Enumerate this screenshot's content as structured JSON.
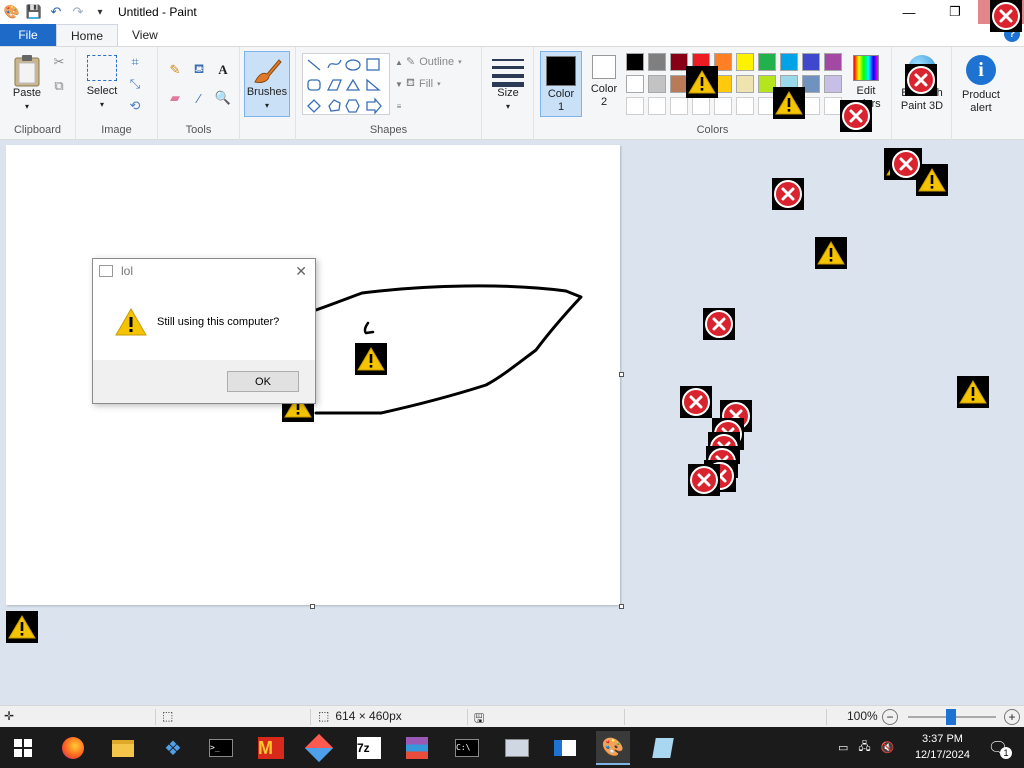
{
  "window": {
    "title": "Untitled - Paint",
    "minimize_glyph": "—",
    "restore_glyph": "❐",
    "close_glyph": "✕"
  },
  "tabs": [
    {
      "label": "File"
    },
    {
      "label": "Home"
    },
    {
      "label": "View"
    }
  ],
  "ribbon": {
    "clipboard": {
      "paste_label": "Paste",
      "group_label": "Clipboard"
    },
    "image": {
      "select_label": "Select",
      "group_label": "Image"
    },
    "tools": {
      "group_label": "Tools"
    },
    "brushes": {
      "label": "Brushes"
    },
    "shapes": {
      "outline_label": "Outline",
      "fill_label": "Fill",
      "group_label": "Shapes"
    },
    "size": {
      "label": "Size"
    },
    "colors": {
      "color1_label": "Color 1",
      "color2_label": "Color 2",
      "group_label": "Colors",
      "edit_label": "Edit colors",
      "paint3d_label": "Edit with Paint 3D",
      "product_alert_label": "Product alert",
      "color1": "#000000",
      "color2": "#ffffff",
      "palette_row1": [
        "#000000",
        "#7f7f7f",
        "#880015",
        "#ed1c24",
        "#ff7f27",
        "#fff200",
        "#22b14c",
        "#00a2e8",
        "#3f48cc",
        "#a349a4"
      ],
      "palette_row2": [
        "#ffffff",
        "#c3c3c3",
        "#b97a57",
        "#ffaec9",
        "#ffc90e",
        "#efe4b0",
        "#b5e61d",
        "#99d9ea",
        "#7092be",
        "#c8bfe7"
      ]
    }
  },
  "dialog": {
    "title": "lol",
    "message": "Still using this computer?",
    "ok_label": "OK"
  },
  "statusbar": {
    "canvas_size": "614 × 460px",
    "zoom": "100%"
  },
  "taskbar": {
    "time": "3:37 PM",
    "date": "12/17/2024",
    "notification_count": "1"
  },
  "colors": {
    "accent": "#1e6ac9",
    "workspace": "#dae3ee",
    "warning_yellow": "#f5c400",
    "error_red": "#d9232e"
  }
}
